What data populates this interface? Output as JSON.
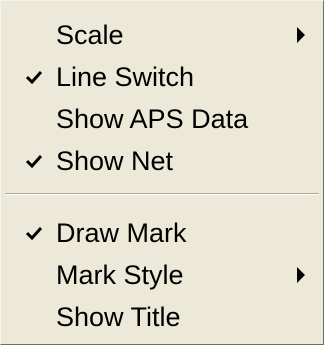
{
  "menu": {
    "items": [
      {
        "label": "Scale",
        "checked": false,
        "submenu": true
      },
      {
        "label": "Line Switch",
        "checked": true,
        "submenu": false
      },
      {
        "label": "Show APS Data",
        "checked": false,
        "submenu": false
      },
      {
        "label": "Show Net",
        "checked": true,
        "submenu": false
      },
      {
        "label": "Draw Mark",
        "checked": true,
        "submenu": false
      },
      {
        "label": "Mark Style",
        "checked": false,
        "submenu": true
      },
      {
        "label": "Show Title",
        "checked": false,
        "submenu": false
      }
    ]
  },
  "colors": {
    "background": "#ece9d8",
    "text": "#000000",
    "separator_dark": "#aca899",
    "separator_light": "#ffffff"
  },
  "icons": {
    "check": "check-icon",
    "submenu_arrow": "submenu-arrow-icon"
  }
}
